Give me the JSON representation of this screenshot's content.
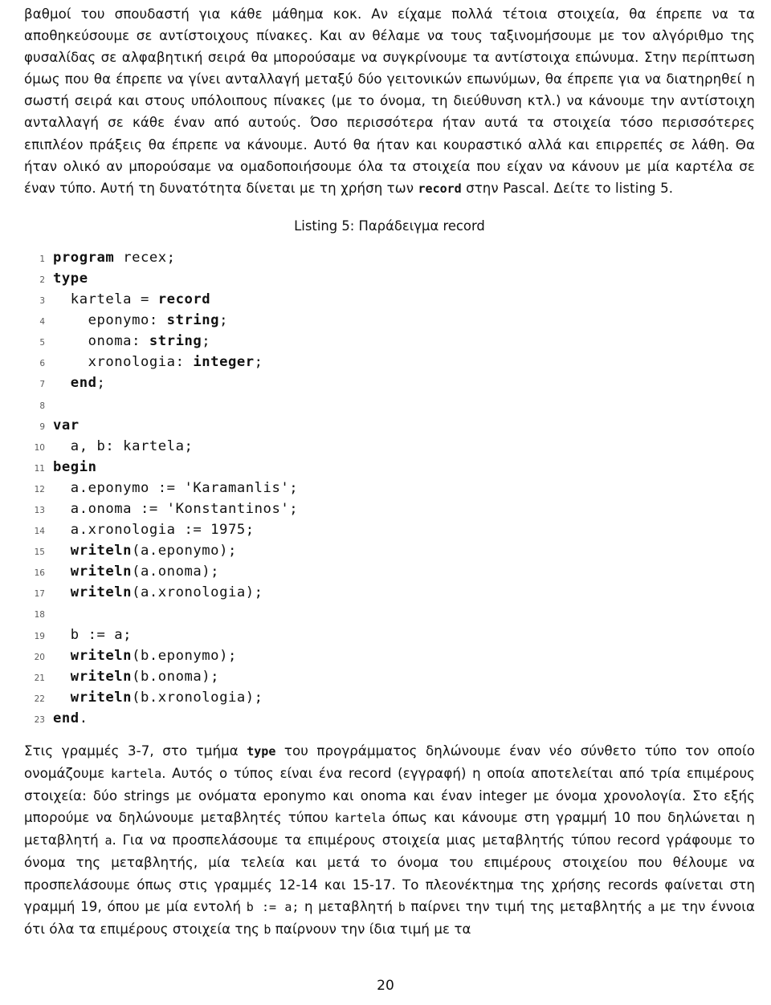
{
  "document": {
    "page_number": "20"
  },
  "paragraphs": {
    "intro": "βαθμοί του σπουδαστή για κάθε μάθημα κοκ. Αν είχαμε πολλά τέτοια στοιχεία, θα έπρεπε να τα αποθηκεύσουμε σε αντίστοιχους πίνακες. Και αν θέλαμε να τους ταξινομήσουμε με τον αλγόριθμο της φυσαλίδας σε αλφαβητική σειρά θα μπορούσαμε να συγκρίνουμε τα αντίστοιχα επώνυμα. Στην περίπτωση όμως που θα έπρεπε να γίνει ανταλλαγή μεταξύ δύο γειτονικών επωνύμων, θα έπρεπε για να διατηρηθεί η σωστή σειρά και στους υπόλοιπους πίνακες (με το όνομα, τη διεύθυνση κτλ.) να κάνουμε την αντίστοιχη ανταλλαγή σε κάθε έναν από αυτούς. Όσο περισσότερα ήταν αυτά τα στοιχεία τόσο περισσότερες επιπλέον πράξεις θα έπρεπε να κάνουμε. Αυτό θα ήταν και κουραστικό αλλά και επιρρεπές σε λάθη. Θα ήταν ολικό αν μπορούσαμε να ομαδοποιήσουμε όλα τα στοιχεία που είχαν να κάνουν με μία καρτέλα σε έναν τύπο. Αυτή τη δυνατότητα δίνεται με τη χρήση των ",
    "intro_code": "record",
    "intro_tail": " στην Pascal. Δείτε το listing 5.",
    "explain_1": "Στις γραμμές 3-7, στο τμήμα ",
    "explain_1_code": "type",
    "explain_2": " του προγράμματος δηλώνουμε έναν νέο σύνθετο τύπο τον οποίο ονομάζουμε ",
    "explain_2_code": "kartela",
    "explain_3": ". Αυτός ο τύπος είναι ένα record (εγγραφή) η οποία αποτελείται από τρία επιμέρους στοιχεία: δύο strings με ονόματα eponymo και onoma και έναν integer με όνομα χρονολογία. Στο εξής μπορούμε να δηλώνουμε μεταβλητές τύπου ",
    "explain_3_code": "kartela",
    "explain_4": " όπως και κάνουμε στη γραμμή 10 που δηλώνεται η μεταβλητή ",
    "explain_4_code": "a",
    "explain_5": ". Για να προσπελάσουμε τα επιμέρους στοιχεία μιας μεταβλητής τύπου record γράφουμε το όνομα της μεταβλητής, μία τελεία και μετά το όνομα του επιμέρους στοιχείου που θέλουμε να προσπελάσουμε όπως στις γραμμές 12-14 και 15-17. Το πλεονέκτημα της χρήσης records φαίνεται στη γραμμή 19, όπου με μία εντολή ",
    "explain_5_code": "b := a;",
    "explain_6": " η μεταβλητή ",
    "explain_6_code": "b",
    "explain_7": " παίρνει την τιμή της μεταβλητής ",
    "explain_7_code": "a",
    "explain_8": " με την έννοια ότι όλα τα επιμέρους στοιχεία της ",
    "explain_8_code": "b",
    "explain_9": " παίρνουν την ίδια τιμή με τα"
  },
  "listing": {
    "caption": "Listing 5: Παράδειγμα record",
    "lines": [
      {
        "no": "1",
        "text": "program recex;",
        "bold_spans": [
          [
            0,
            7
          ]
        ]
      },
      {
        "no": "2",
        "text": "type",
        "bold_spans": [
          [
            0,
            4
          ]
        ]
      },
      {
        "no": "3",
        "text": "  kartela = record",
        "bold_spans": [
          [
            12,
            18
          ]
        ]
      },
      {
        "no": "4",
        "text": "    eponymo: string;",
        "bold_spans": [
          [
            13,
            19
          ]
        ]
      },
      {
        "no": "5",
        "text": "    onoma: string;",
        "bold_spans": [
          [
            11,
            17
          ]
        ]
      },
      {
        "no": "6",
        "text": "    xronologia: integer;",
        "bold_spans": [
          [
            16,
            23
          ]
        ]
      },
      {
        "no": "7",
        "text": "  end;",
        "bold_spans": [
          [
            2,
            5
          ]
        ]
      },
      {
        "no": "8",
        "text": "",
        "bold_spans": []
      },
      {
        "no": "9",
        "text": "var",
        "bold_spans": [
          [
            0,
            3
          ]
        ]
      },
      {
        "no": "10",
        "text": "  a, b: kartela;",
        "bold_spans": []
      },
      {
        "no": "11",
        "text": "begin",
        "bold_spans": [
          [
            0,
            5
          ]
        ]
      },
      {
        "no": "12",
        "text": "  a.eponymo := 'Karamanlis';",
        "bold_spans": []
      },
      {
        "no": "13",
        "text": "  a.onoma := 'Konstantinos';",
        "bold_spans": []
      },
      {
        "no": "14",
        "text": "  a.xronologia := 1975;",
        "bold_spans": []
      },
      {
        "no": "15",
        "text": "  writeln(a.eponymo);",
        "bold_spans": [
          [
            2,
            9
          ]
        ]
      },
      {
        "no": "16",
        "text": "  writeln(a.onoma);",
        "bold_spans": [
          [
            2,
            9
          ]
        ]
      },
      {
        "no": "17",
        "text": "  writeln(a.xronologia);",
        "bold_spans": [
          [
            2,
            9
          ]
        ]
      },
      {
        "no": "18",
        "text": "",
        "bold_spans": []
      },
      {
        "no": "19",
        "text": "  b := a;",
        "bold_spans": []
      },
      {
        "no": "20",
        "text": "  writeln(b.eponymo);",
        "bold_spans": [
          [
            2,
            9
          ]
        ]
      },
      {
        "no": "21",
        "text": "  writeln(b.onoma);",
        "bold_spans": [
          [
            2,
            9
          ]
        ]
      },
      {
        "no": "22",
        "text": "  writeln(b.xronologia);",
        "bold_spans": [
          [
            2,
            9
          ]
        ]
      },
      {
        "no": "23",
        "text": "end.",
        "bold_spans": [
          [
            0,
            3
          ]
        ]
      }
    ]
  }
}
